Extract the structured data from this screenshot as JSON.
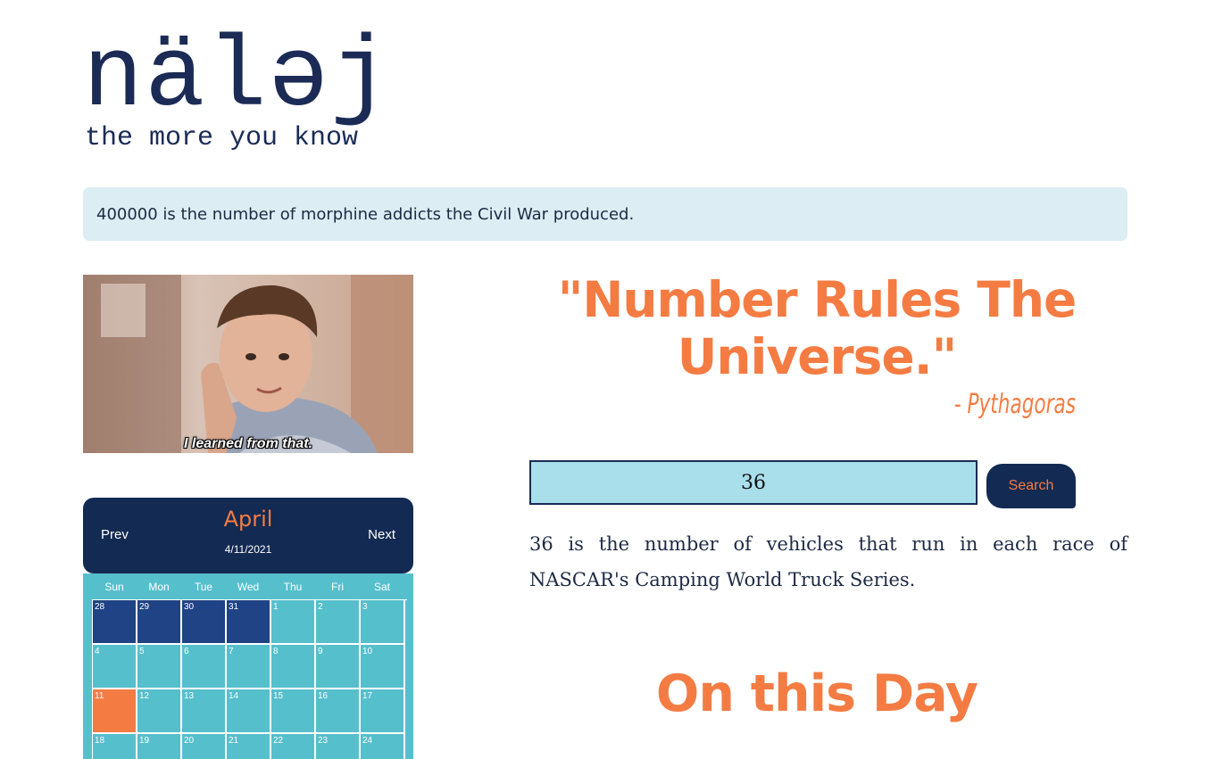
{
  "logo": {
    "word": "näləj",
    "tagline": "the more you know"
  },
  "fact_banner": "400000 is the number of morphine addicts the Civil War produced.",
  "gif": {
    "caption": "I learned from that."
  },
  "calendar": {
    "prev_label": "Prev",
    "next_label": "Next",
    "month": "April",
    "date": "4/11/2021",
    "weekdays": [
      "Sun",
      "Mon",
      "Tue",
      "Wed",
      "Thu",
      "Fri",
      "Sat"
    ],
    "days": [
      {
        "n": "28",
        "state": "prev"
      },
      {
        "n": "29",
        "state": "prev"
      },
      {
        "n": "30",
        "state": "prev"
      },
      {
        "n": "31",
        "state": "prev"
      },
      {
        "n": "1",
        "state": ""
      },
      {
        "n": "2",
        "state": ""
      },
      {
        "n": "3",
        "state": ""
      },
      {
        "n": "4",
        "state": ""
      },
      {
        "n": "5",
        "state": ""
      },
      {
        "n": "6",
        "state": ""
      },
      {
        "n": "7",
        "state": ""
      },
      {
        "n": "8",
        "state": ""
      },
      {
        "n": "9",
        "state": ""
      },
      {
        "n": "10",
        "state": ""
      },
      {
        "n": "11",
        "state": "today"
      },
      {
        "n": "12",
        "state": ""
      },
      {
        "n": "13",
        "state": ""
      },
      {
        "n": "14",
        "state": ""
      },
      {
        "n": "15",
        "state": ""
      },
      {
        "n": "16",
        "state": ""
      },
      {
        "n": "17",
        "state": ""
      },
      {
        "n": "18",
        "state": ""
      },
      {
        "n": "19",
        "state": ""
      },
      {
        "n": "20",
        "state": ""
      },
      {
        "n": "21",
        "state": ""
      },
      {
        "n": "22",
        "state": ""
      },
      {
        "n": "23",
        "state": ""
      },
      {
        "n": "24",
        "state": ""
      }
    ]
  },
  "quote": {
    "text": "\"Number Rules The Universe.\"",
    "author": "- Pythagoras"
  },
  "search": {
    "value": "36",
    "button_label": "Search"
  },
  "result_text": "36 is the number of vehicles that run in each race of NASCAR's Camping World Truck Series.",
  "on_this_day_title": "On this Day",
  "colors": {
    "accent_orange": "#f47c43",
    "navy": "#132a52",
    "teal": "#56bfcc",
    "input_bg": "#a9dfeb",
    "banner_bg": "#dcedf4"
  }
}
